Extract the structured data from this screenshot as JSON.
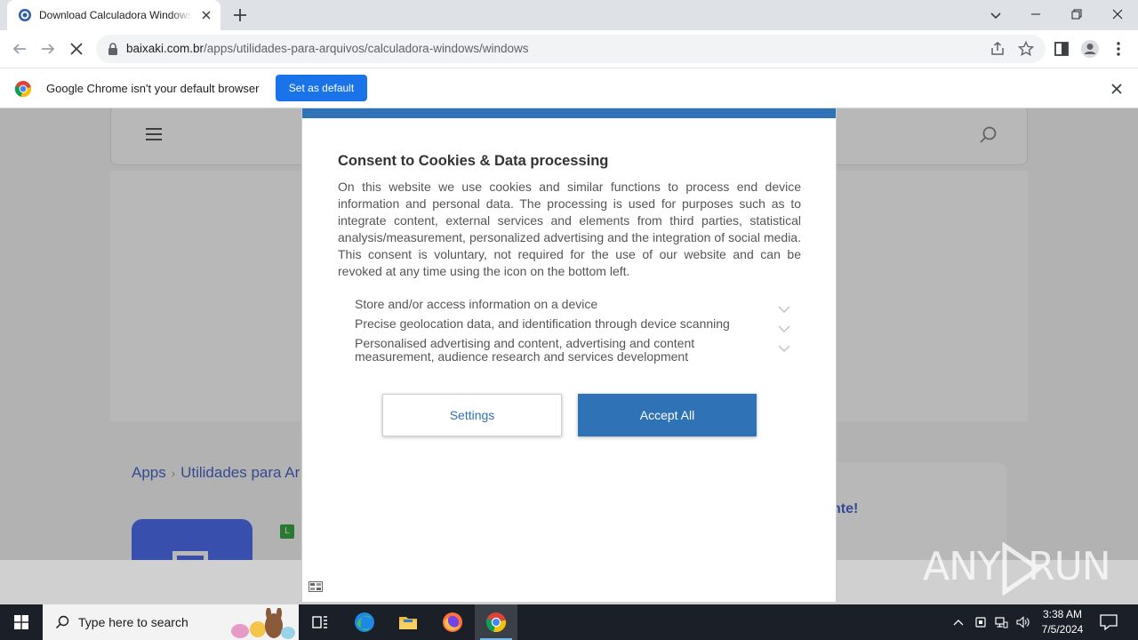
{
  "browser": {
    "tab": {
      "title": "Download Calculadora Windows"
    },
    "url": {
      "domain": "baixaki.com.br",
      "path": "/apps/utilidades-para-arquivos/calculadora-windows/windows"
    }
  },
  "infobar": {
    "message": "Google Chrome isn't your default browser",
    "set_default_label": "Set as default"
  },
  "page": {
    "breadcrumb": {
      "first": "Apps",
      "separator": "›",
      "second": "Utilidades para Ar"
    },
    "rating_badge": "L",
    "promo_text": "nte!"
  },
  "consent": {
    "title": "Consent to Cookies & Data processing",
    "body": "On this website we use cookies and similar functions to process end device information and personal data. The processing is used for purposes such as to integrate content, external services and elements from third parties, statistical analysis/measurement, personalized advertising and the integration of social media. This consent is voluntary, not required for the use of our website and can be revoked at any time using the icon on the bottom left.",
    "purposes": [
      {
        "label": "Store and/or access information on a device"
      },
      {
        "label": "Precise geolocation data, and identification through device scanning"
      },
      {
        "label": "Personalised advertising and content, advertising and content measurement, audience research and services development"
      }
    ],
    "settings_label": "Settings",
    "accept_label": "Accept All"
  },
  "watermark": {
    "left": "ANY",
    "right": "RUN"
  },
  "taskbar": {
    "search_placeholder": "Type here to search",
    "time": "3:38 AM",
    "date": "7/5/2024"
  },
  "colors": {
    "chrome_blue": "#1a73e8",
    "consent_blue": "#2f72b5",
    "link_blue": "#4b67c9",
    "taskbar": "#1b1f27"
  }
}
